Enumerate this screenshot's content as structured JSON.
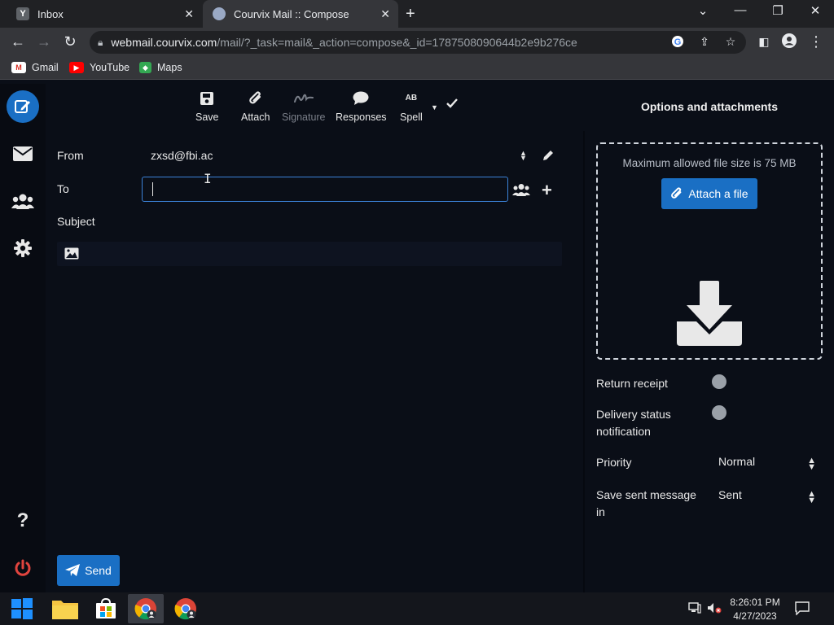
{
  "browser": {
    "tabs": [
      {
        "title": "Inbox",
        "favicon": "Y"
      },
      {
        "title": "Courvix Mail :: Compose"
      }
    ],
    "url_host": "webmail.courvix.com",
    "url_path": "/mail/?_task=mail&_action=compose&_id=1787508090644b2e9b276ce",
    "bookmarks": [
      "Gmail",
      "YouTube",
      "Maps"
    ]
  },
  "toolbar": {
    "save": "Save",
    "attach": "Attach",
    "signature": "Signature",
    "responses": "Responses",
    "spell": "Spell",
    "spell_badge": "AB"
  },
  "form": {
    "from_label": "From",
    "from_value": "zxsd@fbi.ac",
    "to_label": "To",
    "to_value": "",
    "subject_label": "Subject",
    "send_label": "Send"
  },
  "options": {
    "title": "Options and attachments",
    "max_size": "Maximum allowed file size is 75 MB",
    "attach_button": "Attach a file",
    "return_receipt": "Return receipt",
    "return_receipt_on": false,
    "dsn_line1": "Delivery status",
    "dsn_line2": "notification",
    "dsn_on": false,
    "priority_label": "Priority",
    "priority_value": "Normal",
    "save_sent_line1": "Save sent message",
    "save_sent_line2": "in",
    "save_sent_value": "Sent"
  },
  "taskbar": {
    "time": "8:26:01 PM",
    "date": "4/27/2023"
  },
  "colors": {
    "accent": "#1a6fc4",
    "background": "#0a0e17",
    "danger": "#e0443e"
  }
}
